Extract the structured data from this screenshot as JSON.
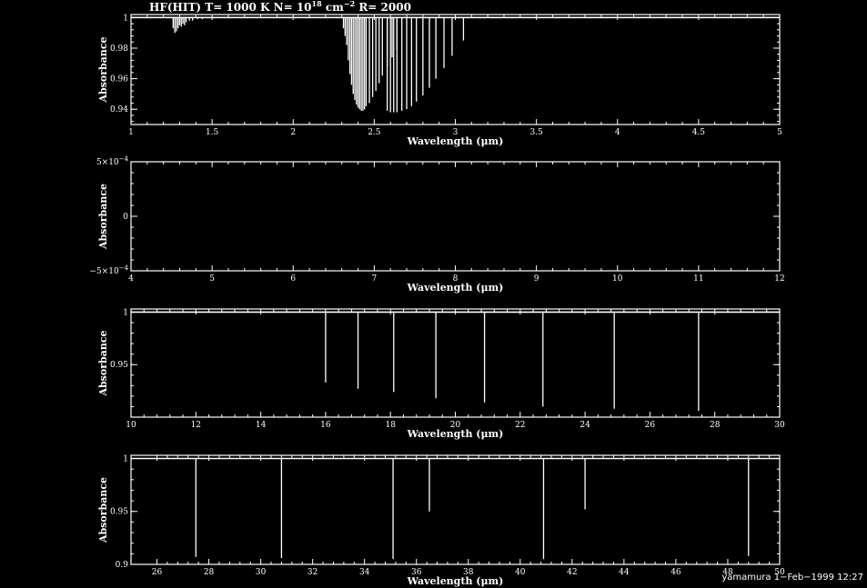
{
  "title": {
    "prefix": "HF(HIT) T= 1000 K N= 10",
    "n_exp": "18",
    "mid": " cm",
    "unit_exp": "−2",
    "suffix": " R= 2000"
  },
  "footer": "yamamura  1−Feb−1999 12:27",
  "colors": {
    "background": "#000000",
    "foreground": "#ffffff"
  },
  "chart_data": [
    {
      "type": "line",
      "xlabel": "Wavelength (μm)",
      "ylabel": "Absorbance",
      "xlim": [
        1,
        5
      ],
      "ylim": [
        0.93,
        1.002
      ],
      "xticks": [
        {
          "v": 1,
          "label": "1"
        },
        {
          "v": 1.5,
          "label": "1.5"
        },
        {
          "v": 2,
          "label": "2"
        },
        {
          "v": 2.5,
          "label": "2.5"
        },
        {
          "v": 3,
          "label": "3"
        },
        {
          "v": 3.5,
          "label": "3.5"
        },
        {
          "v": 4,
          "label": "4"
        },
        {
          "v": 4.5,
          "label": "4.5"
        },
        {
          "v": 5,
          "label": "5"
        }
      ],
      "yticks": [
        {
          "v": 0.94,
          "label": "0.94"
        },
        {
          "v": 0.96,
          "label": "0.96"
        },
        {
          "v": 0.98,
          "label": "0.98"
        },
        {
          "v": 1,
          "label": "1"
        }
      ],
      "baseline": 1,
      "lines": [
        [
          1.26,
          0.993
        ],
        [
          1.27,
          0.99
        ],
        [
          1.28,
          0.991
        ],
        [
          1.29,
          0.993
        ],
        [
          1.3,
          0.995
        ],
        [
          1.31,
          0.994
        ],
        [
          1.32,
          0.996
        ],
        [
          1.33,
          0.995
        ],
        [
          1.34,
          0.997
        ],
        [
          1.36,
          0.998
        ],
        [
          1.38,
          0.998
        ],
        [
          1.41,
          0.999
        ],
        [
          1.44,
          0.999
        ],
        [
          2.31,
          0.993
        ],
        [
          2.32,
          0.988
        ],
        [
          2.33,
          0.982
        ],
        [
          2.34,
          0.972
        ],
        [
          2.35,
          0.963
        ],
        [
          2.36,
          0.956
        ],
        [
          2.37,
          0.95
        ],
        [
          2.38,
          0.946
        ],
        [
          2.39,
          0.943
        ],
        [
          2.4,
          0.941
        ],
        [
          2.41,
          0.94
        ],
        [
          2.42,
          0.939
        ],
        [
          2.43,
          0.939
        ],
        [
          2.44,
          0.94
        ],
        [
          2.45,
          0.942
        ],
        [
          2.47,
          0.944
        ],
        [
          2.49,
          0.948
        ],
        [
          2.51,
          0.952
        ],
        [
          2.53,
          0.957
        ],
        [
          2.55,
          0.962
        ],
        [
          2.58,
          0.968
        ],
        [
          2.61,
          0.974
        ],
        [
          2.64,
          0.979
        ],
        [
          2.58,
          0.939
        ],
        [
          2.6,
          0.938
        ],
        [
          2.62,
          0.938
        ],
        [
          2.64,
          0.938
        ],
        [
          2.67,
          0.939
        ],
        [
          2.7,
          0.94
        ],
        [
          2.73,
          0.942
        ],
        [
          2.76,
          0.945
        ],
        [
          2.8,
          0.949
        ],
        [
          2.84,
          0.954
        ],
        [
          2.88,
          0.96
        ],
        [
          2.93,
          0.967
        ],
        [
          2.98,
          0.975
        ],
        [
          3.05,
          0.985
        ]
      ]
    },
    {
      "type": "line",
      "xlabel": "Wavelength (μm)",
      "ylabel": "Absorbance",
      "xlim": [
        4,
        12
      ],
      "ylim": [
        -0.0005,
        0.0005
      ],
      "xticks": [
        {
          "v": 4,
          "label": "4"
        },
        {
          "v": 5,
          "label": "5"
        },
        {
          "v": 6,
          "label": "6"
        },
        {
          "v": 7,
          "label": "7"
        },
        {
          "v": 8,
          "label": "8"
        },
        {
          "v": 9,
          "label": "9"
        },
        {
          "v": 10,
          "label": "10"
        },
        {
          "v": 11,
          "label": "11"
        },
        {
          "v": 12,
          "label": "12"
        }
      ],
      "yticks": [
        {
          "v": -0.0005,
          "label": "−5×10",
          "sup": "−4"
        },
        {
          "v": 0,
          "label": "0"
        },
        {
          "v": 0.0005,
          "label": "5×10",
          "sup": "−4"
        }
      ],
      "baseline": null,
      "lines": []
    },
    {
      "type": "line",
      "xlabel": "Wavelength (μm)",
      "ylabel": "Absorbance",
      "xlim": [
        10,
        30
      ],
      "ylim": [
        0.9,
        1.003
      ],
      "xticks": [
        {
          "v": 10,
          "label": "10"
        },
        {
          "v": 12,
          "label": "12"
        },
        {
          "v": 14,
          "label": "14"
        },
        {
          "v": 16,
          "label": "16"
        },
        {
          "v": 18,
          "label": "18"
        },
        {
          "v": 20,
          "label": "20"
        },
        {
          "v": 22,
          "label": "22"
        },
        {
          "v": 24,
          "label": "24"
        },
        {
          "v": 26,
          "label": "26"
        },
        {
          "v": 28,
          "label": "28"
        },
        {
          "v": 30,
          "label": "30"
        }
      ],
      "yticks": [
        {
          "v": 0.95,
          "label": "0.95"
        },
        {
          "v": 1,
          "label": "1"
        }
      ],
      "baseline": 1,
      "lines": [
        [
          16.0,
          0.933
        ],
        [
          17.0,
          0.927
        ],
        [
          18.1,
          0.924
        ],
        [
          19.4,
          0.918
        ],
        [
          20.9,
          0.914
        ],
        [
          22.7,
          0.91
        ],
        [
          24.9,
          0.908
        ],
        [
          27.5,
          0.906
        ]
      ]
    },
    {
      "type": "line",
      "xlabel": "Wavelength (μm)",
      "ylabel": "Absorbance",
      "xlim": [
        25,
        50
      ],
      "ylim": [
        0.9,
        1.003
      ],
      "xticks": [
        {
          "v": 26,
          "label": "26"
        },
        {
          "v": 28,
          "label": "28"
        },
        {
          "v": 30,
          "label": "30"
        },
        {
          "v": 32,
          "label": "32"
        },
        {
          "v": 34,
          "label": "34"
        },
        {
          "v": 36,
          "label": "36"
        },
        {
          "v": 38,
          "label": "38"
        },
        {
          "v": 40,
          "label": "40"
        },
        {
          "v": 42,
          "label": "42"
        },
        {
          "v": 44,
          "label": "44"
        },
        {
          "v": 46,
          "label": "46"
        },
        {
          "v": 48,
          "label": "48"
        },
        {
          "v": 50,
          "label": "50"
        }
      ],
      "yticks": [
        {
          "v": 0.9,
          "label": "0.9"
        },
        {
          "v": 0.95,
          "label": "0.95"
        },
        {
          "v": 1,
          "label": "1"
        }
      ],
      "baseline": 1,
      "lines": [
        [
          27.5,
          0.907
        ],
        [
          30.8,
          0.906
        ],
        [
          35.1,
          0.905
        ],
        [
          36.5,
          0.95
        ],
        [
          40.9,
          0.905
        ],
        [
          42.5,
          0.952
        ],
        [
          48.8,
          0.908
        ]
      ]
    }
  ]
}
